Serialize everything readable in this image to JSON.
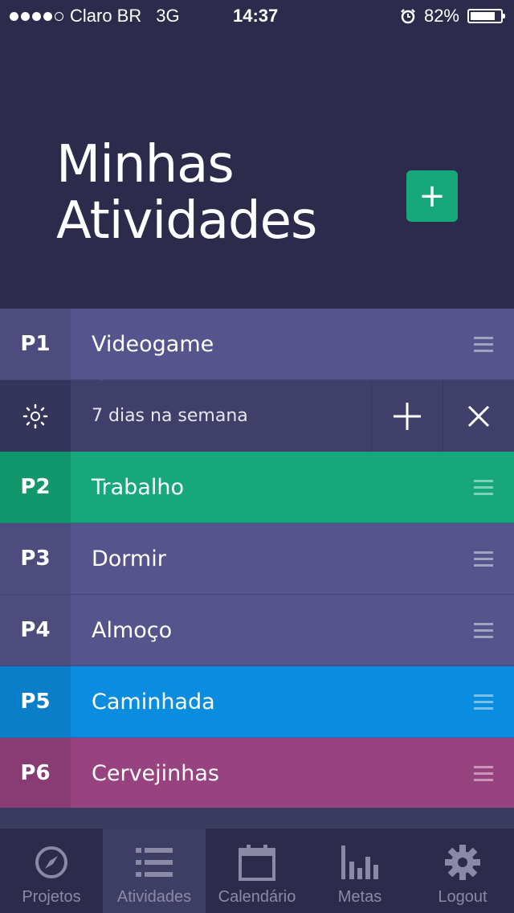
{
  "status_bar": {
    "carrier": "Claro BR",
    "network": "3G",
    "time": "14:37",
    "battery": "82%",
    "battery_level": 0.82,
    "signal_bars_filled": 4,
    "signal_bars_total": 5
  },
  "header": {
    "title_line1": "Minhas",
    "title_line2": "Atividades",
    "add_button_label": "+"
  },
  "expanded_row": {
    "frequency": "7 dias na semana",
    "add_label": "+",
    "close_label": "✕"
  },
  "activities": [
    {
      "priority": "P1",
      "name": "Videogame",
      "color": "#56548c",
      "badge_color": "#4e4c7f"
    },
    {
      "priority": "P2",
      "name": "Trabalho",
      "color": "#16a77a",
      "badge_color": "#12966c"
    },
    {
      "priority": "P3",
      "name": "Dormir",
      "color": "#56548c",
      "badge_color": "#4e4c7f"
    },
    {
      "priority": "P4",
      "name": "Almoço",
      "color": "#56548c",
      "badge_color": "#4e4c7f"
    },
    {
      "priority": "P5",
      "name": "Caminhada",
      "color": "#0a8ddf",
      "badge_color": "#0a7ec9"
    },
    {
      "priority": "P6",
      "name": "Cervejinhas",
      "color": "#97437f",
      "badge_color": "#893c73"
    }
  ],
  "tabs": [
    {
      "label": "Projetos",
      "icon": "compass-icon",
      "active": false
    },
    {
      "label": "Atividades",
      "icon": "list-icon",
      "active": true
    },
    {
      "label": "Calendário",
      "icon": "calendar-icon",
      "active": false
    },
    {
      "label": "Metas",
      "icon": "bar-chart-icon",
      "active": false
    },
    {
      "label": "Logout",
      "icon": "gear-icon",
      "active": false
    }
  ]
}
